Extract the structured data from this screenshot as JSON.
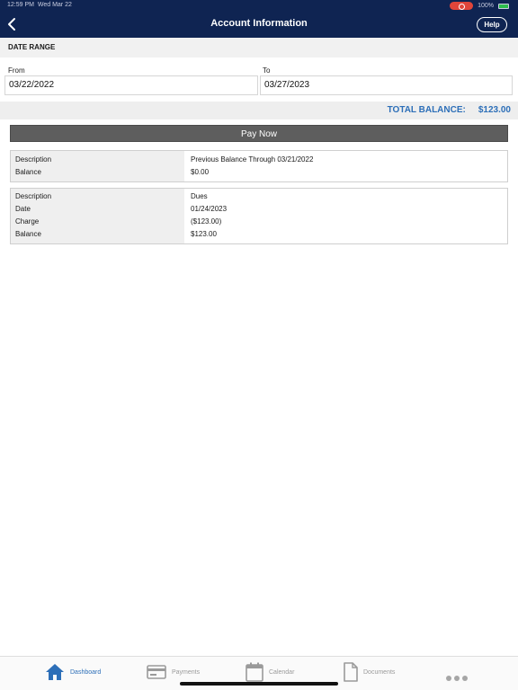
{
  "status_bar": {
    "time": "12:59 PM",
    "date": "Wed Mar 22",
    "battery": "100%"
  },
  "header": {
    "title": "Account Information",
    "help_label": "Help",
    "back_icon": "chevron-left-icon"
  },
  "date_range": {
    "heading": "DATE RANGE",
    "from_label": "From",
    "from_value": "03/22/2022",
    "to_label": "To",
    "to_value": "03/27/2023"
  },
  "total": {
    "label": "TOTAL BALANCE:",
    "value": "$123.00"
  },
  "pay_now_label": "Pay Now",
  "entries": [
    {
      "rows": [
        {
          "label": "Description",
          "value": "Previous Balance Through 03/21/2022"
        },
        {
          "label": "Balance",
          "value": "$0.00"
        }
      ]
    },
    {
      "rows": [
        {
          "label": "Description",
          "value": "Dues"
        },
        {
          "label": "Date",
          "value": "01/24/2023"
        },
        {
          "label": "Charge",
          "value": "($123.00)"
        },
        {
          "label": "Balance",
          "value": "$123.00"
        }
      ]
    }
  ],
  "tabs": [
    {
      "label": "Dashboard",
      "icon": "home-icon",
      "active": true
    },
    {
      "label": "Payments",
      "icon": "credit-card-icon",
      "active": false
    },
    {
      "label": "Calendar",
      "icon": "calendar-icon",
      "active": false
    },
    {
      "label": "Documents",
      "icon": "document-icon",
      "active": false
    }
  ],
  "more_icon": "more-dots-icon",
  "colors": {
    "header_bg": "#0f2452",
    "accent": "#2d6fb8",
    "pay_button": "#5e5e5e"
  }
}
